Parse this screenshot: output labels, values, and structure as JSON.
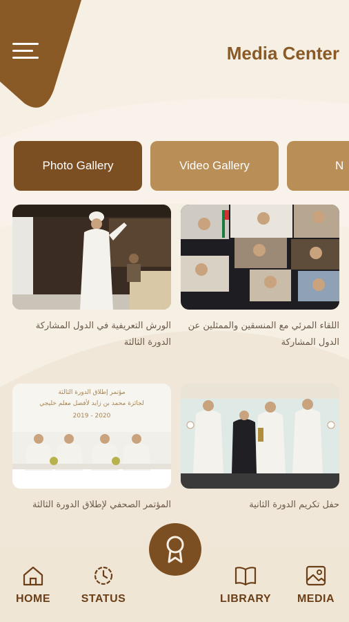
{
  "header": {
    "title": "Media Center"
  },
  "tabs": [
    {
      "label": "Photo Gallery",
      "active": true
    },
    {
      "label": "Video Gallery",
      "active": false
    },
    {
      "label": "N",
      "active": false
    }
  ],
  "cards": [
    {
      "caption": "الورش التعريفية في الدول المشاركة الدورة الثالثة"
    },
    {
      "caption": "اللقاء المرئي مع المنسقين والممثلين عن الدول المشاركة"
    },
    {
      "caption": "المؤتمر الصحفي لإطلاق الدورة الثالثة",
      "banner_line1": "مؤتمر إطلاق الدورة الثالثة",
      "banner_line2": "لجائزة محمد بن زايد لأفضل معلم خليجي",
      "banner_line3": "2019 - 2020"
    },
    {
      "caption": "حفل تكريم الدورة الثانية"
    }
  ],
  "bottom_nav": {
    "home": "HOME",
    "status": "STATUS",
    "library": "LIBRARY",
    "media": "MEDIA"
  },
  "colors": {
    "primary": "#7c4f22",
    "secondary": "#b98e57",
    "background": "#f6efe4"
  }
}
